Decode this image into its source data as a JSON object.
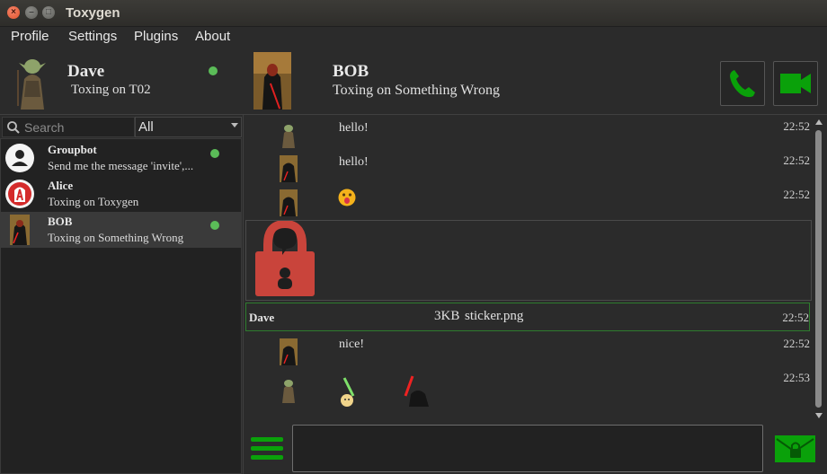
{
  "window": {
    "title": "Toxygen"
  },
  "menu": [
    "Profile",
    "Settings",
    "Plugins",
    "About"
  ],
  "profile": {
    "name": "Dave",
    "status": "Toxing on T02",
    "online": true
  },
  "contact": {
    "name": "BOB",
    "status": "Toxing on Something Wrong"
  },
  "search": {
    "placeholder": "Search",
    "value": ""
  },
  "filter": {
    "selected": "All"
  },
  "friends": [
    {
      "name": "Groupbot",
      "status": "Send me the message 'invite',...",
      "online": true,
      "avatar": "default-user-icon"
    },
    {
      "name": "Alice",
      "status": "Toxing on Toxygen",
      "online": false,
      "avatar": "alice-avatar"
    },
    {
      "name": "BOB",
      "status": "Toxing on Something Wrong",
      "online": true,
      "avatar": "vader-avatar",
      "selected": true
    }
  ],
  "messages": [
    {
      "sender": "Dave",
      "text": "hello!",
      "time": "22:52"
    },
    {
      "sender": "BOB",
      "text": "hello!",
      "time": "22:52"
    },
    {
      "sender": "BOB",
      "text": "",
      "emoji": "tongue-emoji",
      "time": "22:52"
    },
    {
      "sticker": "padlock-sticker"
    },
    {
      "file": {
        "sender": "Dave",
        "size": "3KB",
        "name": "sticker.png",
        "time": "22:52"
      }
    },
    {
      "sender": "BOB",
      "text": "nice!",
      "time": "22:52"
    },
    {
      "sender": "Dave",
      "text": "",
      "stickers": [
        "lightsaber-green",
        "lightsaber-red"
      ],
      "time": "22:53"
    }
  ],
  "colors": {
    "accent": "#0aa10a",
    "online": "#5bbc58",
    "sticker_lock": "#c9443b"
  }
}
